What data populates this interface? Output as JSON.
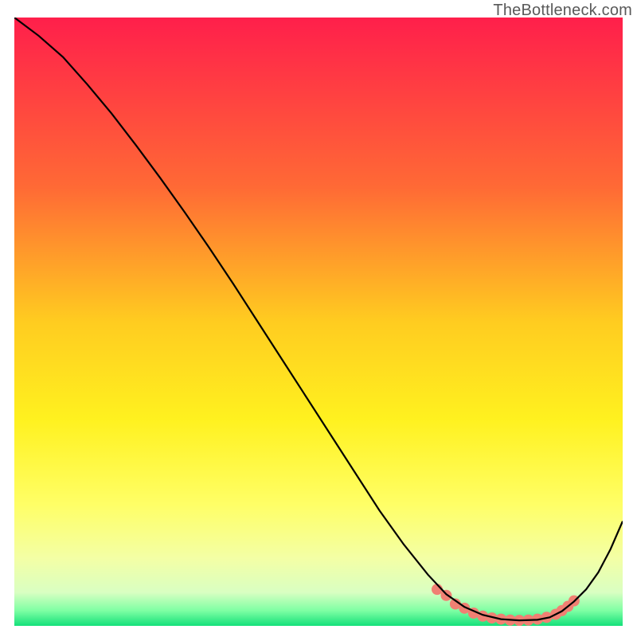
{
  "watermark": "TheBottleneck.com",
  "chart_data": {
    "type": "line",
    "title": "",
    "xlabel": "",
    "ylabel": "",
    "xlim": [
      0,
      100
    ],
    "ylim": [
      0,
      100
    ],
    "grid": false,
    "legend": false,
    "gradient_stops": [
      {
        "offset": 0.0,
        "color": "#ff1f4b"
      },
      {
        "offset": 0.28,
        "color": "#ff6a35"
      },
      {
        "offset": 0.5,
        "color": "#ffcc20"
      },
      {
        "offset": 0.66,
        "color": "#fff11f"
      },
      {
        "offset": 0.8,
        "color": "#ffff66"
      },
      {
        "offset": 0.89,
        "color": "#f3ffa6"
      },
      {
        "offset": 0.945,
        "color": "#d9ffc2"
      },
      {
        "offset": 0.975,
        "color": "#7effa3"
      },
      {
        "offset": 1.0,
        "color": "#14e07a"
      }
    ],
    "series": [
      {
        "name": "curve",
        "stroke": "#000000",
        "stroke_width": 2.2,
        "x": [
          0,
          4,
          8,
          12,
          16,
          20,
          24,
          28,
          32,
          36,
          40,
          44,
          48,
          52,
          56,
          60,
          64,
          68,
          71,
          74,
          77,
          80,
          83,
          86,
          88,
          90,
          92,
          94,
          96,
          98,
          100
        ],
        "y": [
          100,
          97,
          93.5,
          89,
          84.2,
          79,
          73.6,
          68,
          62.2,
          56.2,
          50.0,
          43.8,
          37.6,
          31.4,
          25.2,
          19.0,
          13.4,
          8.4,
          5.2,
          3.1,
          1.8,
          1.1,
          0.9,
          1.0,
          1.4,
          2.4,
          4.0,
          6.0,
          8.8,
          12.6,
          17.2
        ]
      }
    ],
    "markers": {
      "name": "dots",
      "color": "#f08073",
      "radius": 7,
      "x": [
        69.5,
        71.0,
        72.5,
        74.0,
        75.5,
        77.0,
        78.5,
        80.0,
        81.5,
        83.0,
        84.5,
        86.0,
        87.5,
        89.0,
        90.0,
        91.0,
        92.0
      ],
      "y": [
        6.0,
        5.0,
        3.6,
        2.9,
        2.1,
        1.6,
        1.3,
        1.1,
        0.95,
        0.9,
        0.95,
        1.1,
        1.4,
        1.9,
        2.5,
        3.2,
        4.1
      ]
    }
  }
}
